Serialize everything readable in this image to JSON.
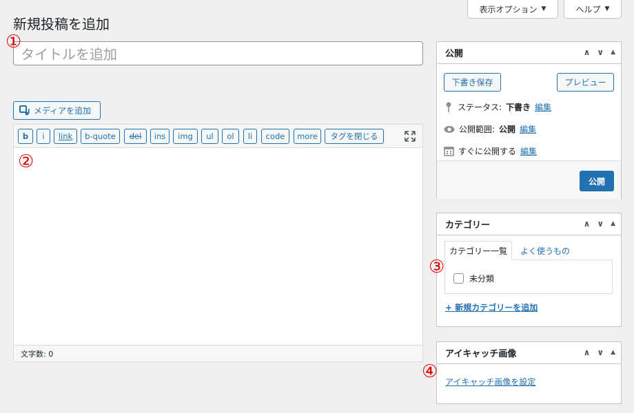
{
  "top_buttons": {
    "screen_options": "表示オプション",
    "help": "ヘルプ"
  },
  "page_title": "新規投稿を追加",
  "title_placeholder": "タイトルを追加",
  "markers": [
    "①",
    "②",
    "③",
    "④"
  ],
  "media_button": "メディアを追加",
  "quicktags": [
    "b",
    "i",
    "link",
    "b-quote",
    "del",
    "ins",
    "img",
    "ul",
    "ol",
    "li",
    "code",
    "more",
    "タグを閉じる"
  ],
  "word_count": "文字数: 0",
  "publish_box": {
    "title": "公開",
    "save_draft": "下書き保存",
    "preview": "プレビュー",
    "status_label": "ステータス:",
    "status_value": "下書き",
    "visibility_label": "公開範囲:",
    "visibility_value": "公開",
    "schedule_label": "すぐに公開する",
    "edit": "編集",
    "publish": "公開"
  },
  "category_box": {
    "title": "カテゴリー",
    "tab_all": "カテゴリー一覧",
    "tab_popular": "よく使うもの",
    "item": "未分類",
    "add_new": "+ 新規カテゴリーを追加"
  },
  "thumbnail_box": {
    "title": "アイキャッチ画像",
    "set_link": "アイキャッチ画像を設定"
  },
  "colors": {
    "accent": "#2271b1",
    "marker": "#e00000",
    "background": "#f0f0f1"
  }
}
